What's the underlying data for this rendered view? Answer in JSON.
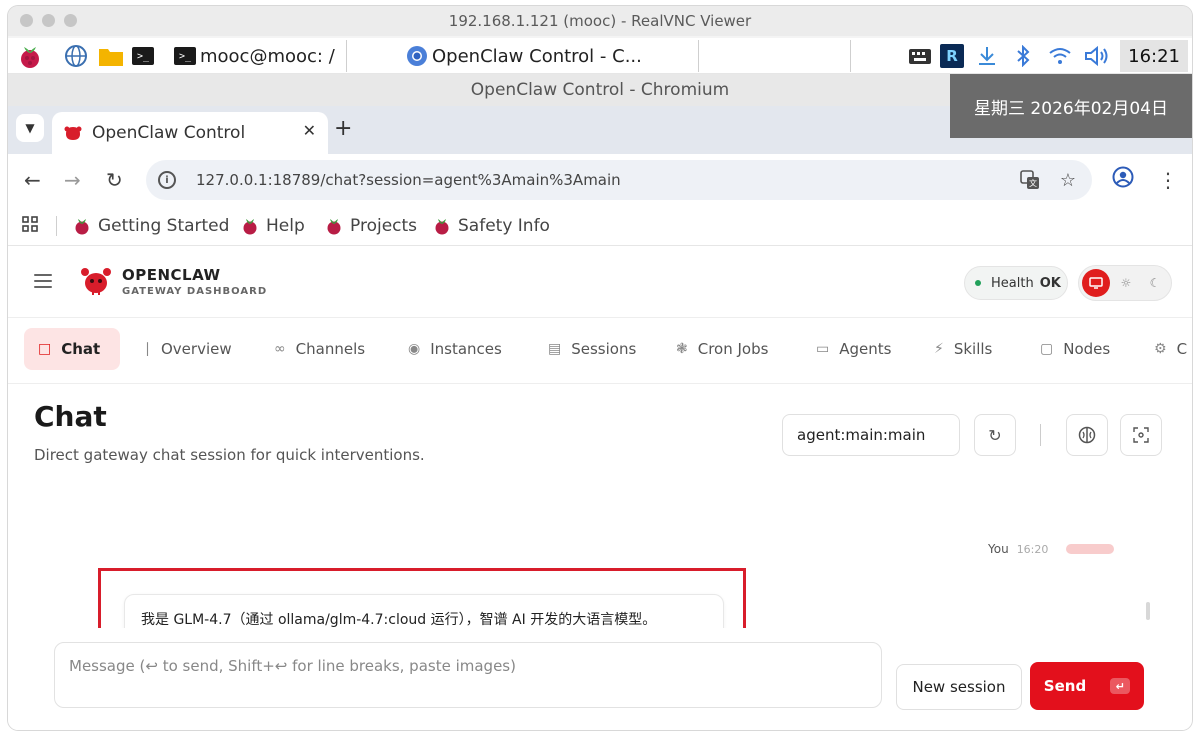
{
  "vnc": {
    "window_title": "192.168.1.121 (mooc) - RealVNC Viewer"
  },
  "taskbar": {
    "terminal_label": "mooc@mooc: /",
    "chromium_label": "OpenClaw Control - C...",
    "clock": "16:21"
  },
  "chromium": {
    "window_title": "OpenClaw Control - Chromium",
    "date_overlay": "星期三 2026年02月04日",
    "tab_title": "OpenClaw Control",
    "url": "127.0.0.1:18789/chat?session=agent%3Amain%3Amain"
  },
  "bookmarks": [
    {
      "label": "Getting Started"
    },
    {
      "label": "Help"
    },
    {
      "label": "Projects"
    },
    {
      "label": "Safety Info"
    }
  ],
  "app": {
    "brand_title": "OPENCLAW",
    "brand_subtitle": "GATEWAY DASHBOARD",
    "health_label": "Health",
    "health_status": "OK",
    "nav_tabs": [
      {
        "label": "Chat",
        "icon": "chat-icon",
        "active": true
      },
      {
        "label": "Overview",
        "icon": "bar-chart-icon"
      },
      {
        "label": "Channels",
        "icon": "link-icon"
      },
      {
        "label": "Instances",
        "icon": "radio-icon"
      },
      {
        "label": "Sessions",
        "icon": "document-icon"
      },
      {
        "label": "Cron Jobs",
        "icon": "loader-icon"
      },
      {
        "label": "Agents",
        "icon": "folder-icon"
      },
      {
        "label": "Skills",
        "icon": "zap-icon"
      },
      {
        "label": "Nodes",
        "icon": "monitor-icon"
      },
      {
        "label": "C",
        "icon": "gear-icon"
      }
    ],
    "page_title": "Chat",
    "page_subtitle": "Direct gateway chat session for quick interventions.",
    "session_key": "agent:main:main",
    "chat": {
      "user_label": "You",
      "user_time": "16:20",
      "assistant_message": "我是 GLM-4.7（通过 ollama/glm-4.7:cloud 运行），智谱 AI 开发的大语言模型。"
    },
    "composer_placeholder": "Message (↩ to send, Shift+↩ for line breaks, paste images)",
    "new_session_label": "New session",
    "send_label": "Send",
    "send_kbd": "↵"
  },
  "colors": {
    "accent": "#e3101c",
    "active_tab_bg": "#fde4e4",
    "highlight_border": "#d81d2b"
  }
}
